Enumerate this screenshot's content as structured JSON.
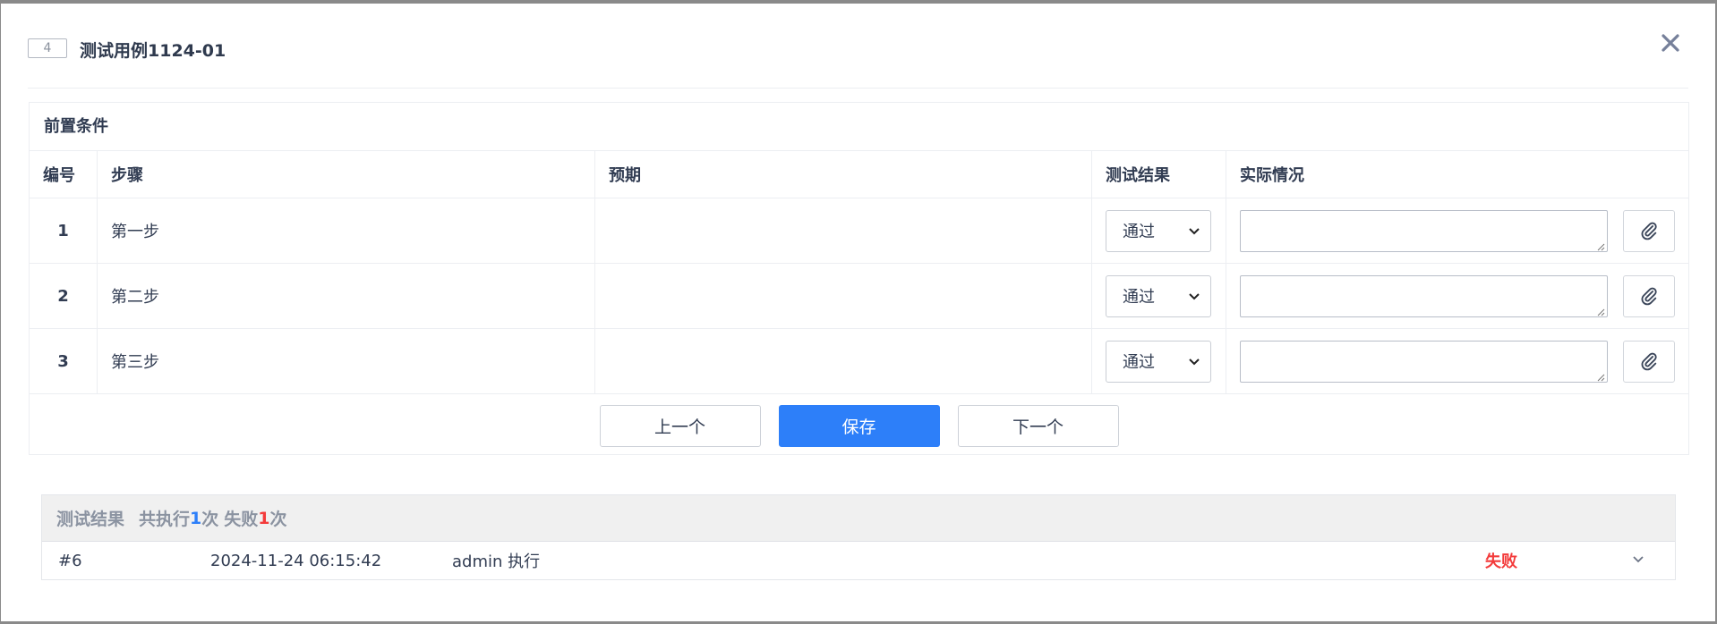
{
  "header": {
    "case_id": "4",
    "title": "测试用例1124-01",
    "close_label": "✕"
  },
  "steps": {
    "precondition_label": "前置条件",
    "columns": {
      "num": "编号",
      "step": "步骤",
      "expected": "预期",
      "result": "测试结果",
      "actual": "实际情况"
    },
    "rows": [
      {
        "num": "1",
        "step": "第一步",
        "expected": "",
        "result": "通过",
        "actual": ""
      },
      {
        "num": "2",
        "step": "第二步",
        "expected": "",
        "result": "通过",
        "actual": ""
      },
      {
        "num": "3",
        "step": "第三步",
        "expected": "",
        "result": "通过",
        "actual": ""
      }
    ],
    "result_options": [
      "通过"
    ]
  },
  "actions": {
    "prev_label": "上一个",
    "save_label": "保存",
    "next_label": "下一个"
  },
  "results": {
    "title": "测试结果",
    "total_prefix": "共执行",
    "total_count": "1",
    "total_suffix": "次",
    "fail_prefix": "失败",
    "fail_count": "1",
    "fail_suffix": "次",
    "records": [
      {
        "id": "#6",
        "time": "2024-11-24 06:15:42",
        "executor": "admin 执行",
        "status": "失败"
      }
    ]
  },
  "colors": {
    "primary": "#2d7ff9",
    "fail": "#f33b3b",
    "text": "#313c52"
  },
  "icons": {
    "close": "close-icon",
    "attach": "paperclip-icon",
    "dropdown": "chevron-down-icon",
    "expand": "chevron-down-icon"
  }
}
